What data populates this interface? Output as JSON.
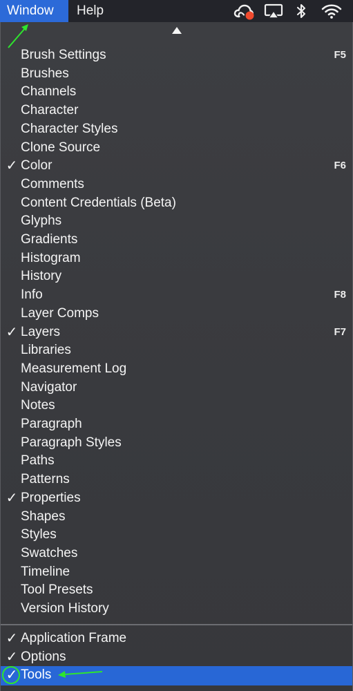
{
  "menubar": {
    "items": [
      {
        "label": "Window",
        "active": true
      },
      {
        "label": "Help",
        "active": false
      }
    ],
    "status_icons": [
      "creative-cloud-icon",
      "airplay-icon",
      "bluetooth-icon",
      "wifi-icon"
    ]
  },
  "menu": {
    "scroll_indicator": "scroll-up-arrow-icon",
    "items": [
      {
        "label": "Brush Settings",
        "checked": false,
        "shortcut": "F5"
      },
      {
        "label": "Brushes",
        "checked": false,
        "shortcut": ""
      },
      {
        "label": "Channels",
        "checked": false,
        "shortcut": ""
      },
      {
        "label": "Character",
        "checked": false,
        "shortcut": ""
      },
      {
        "label": "Character Styles",
        "checked": false,
        "shortcut": ""
      },
      {
        "label": "Clone Source",
        "checked": false,
        "shortcut": ""
      },
      {
        "label": "Color",
        "checked": true,
        "shortcut": "F6"
      },
      {
        "label": "Comments",
        "checked": false,
        "shortcut": ""
      },
      {
        "label": "Content Credentials (Beta)",
        "checked": false,
        "shortcut": ""
      },
      {
        "label": "Glyphs",
        "checked": false,
        "shortcut": ""
      },
      {
        "label": "Gradients",
        "checked": false,
        "shortcut": ""
      },
      {
        "label": "Histogram",
        "checked": false,
        "shortcut": ""
      },
      {
        "label": "History",
        "checked": false,
        "shortcut": ""
      },
      {
        "label": "Info",
        "checked": false,
        "shortcut": "F8"
      },
      {
        "label": "Layer Comps",
        "checked": false,
        "shortcut": ""
      },
      {
        "label": "Layers",
        "checked": true,
        "shortcut": "F7"
      },
      {
        "label": "Libraries",
        "checked": false,
        "shortcut": ""
      },
      {
        "label": "Measurement Log",
        "checked": false,
        "shortcut": ""
      },
      {
        "label": "Navigator",
        "checked": false,
        "shortcut": ""
      },
      {
        "label": "Notes",
        "checked": false,
        "shortcut": ""
      },
      {
        "label": "Paragraph",
        "checked": false,
        "shortcut": ""
      },
      {
        "label": "Paragraph Styles",
        "checked": false,
        "shortcut": ""
      },
      {
        "label": "Paths",
        "checked": false,
        "shortcut": ""
      },
      {
        "label": "Patterns",
        "checked": false,
        "shortcut": ""
      },
      {
        "label": "Properties",
        "checked": true,
        "shortcut": ""
      },
      {
        "label": "Shapes",
        "checked": false,
        "shortcut": ""
      },
      {
        "label": "Styles",
        "checked": false,
        "shortcut": ""
      },
      {
        "label": "Swatches",
        "checked": false,
        "shortcut": ""
      },
      {
        "label": "Timeline",
        "checked": false,
        "shortcut": ""
      },
      {
        "label": "Tool Presets",
        "checked": false,
        "shortcut": ""
      },
      {
        "label": "Version History",
        "checked": false,
        "shortcut": ""
      }
    ],
    "bottom_items": [
      {
        "label": "Application Frame",
        "checked": true,
        "selected": false
      },
      {
        "label": "Options",
        "checked": true,
        "selected": false
      },
      {
        "label": "Tools",
        "checked": true,
        "selected": true
      }
    ],
    "check_glyph": "✓"
  },
  "colors": {
    "highlight": "#2867d6",
    "menu_bg": "#3b3c40",
    "annotation": "#2ee62e"
  }
}
